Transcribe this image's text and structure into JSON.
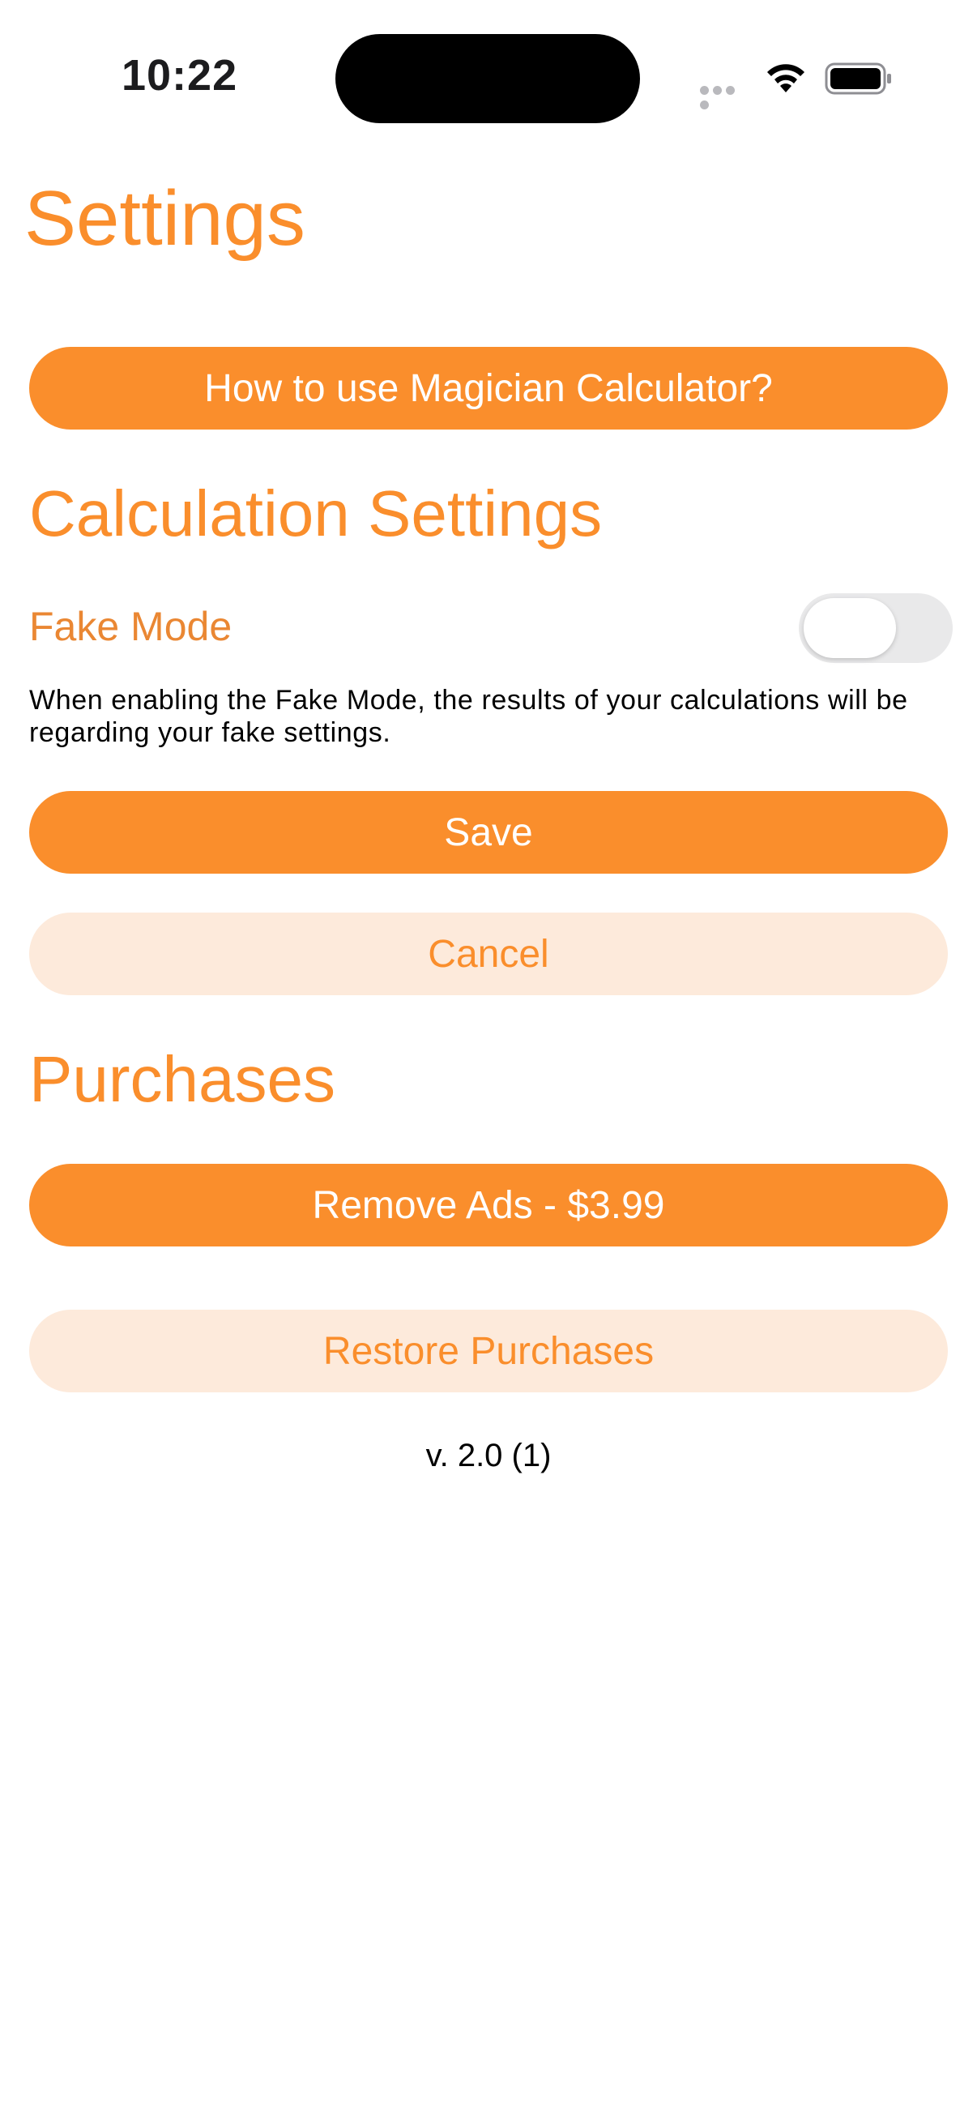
{
  "status_bar": {
    "time": "10:22"
  },
  "page": {
    "title": "Settings"
  },
  "help_button": {
    "label": "How to use Magician Calculator?"
  },
  "calculation_settings": {
    "title": "Calculation Settings",
    "fake_mode_label": "Fake Mode",
    "fake_mode_enabled": false,
    "description": "When enabling the Fake Mode, the results of your calculations will be regarding your fake settings.",
    "save_label": "Save",
    "cancel_label": "Cancel"
  },
  "purchases": {
    "title": "Purchases",
    "remove_ads_label": "Remove Ads - $3.99",
    "restore_label": "Restore Purchases"
  },
  "version": "v. 2.0 (1)",
  "colors": {
    "accent": "#fa8e2c",
    "accent_light": "#fdeadb",
    "toggle_off": "#e9e9ea"
  }
}
